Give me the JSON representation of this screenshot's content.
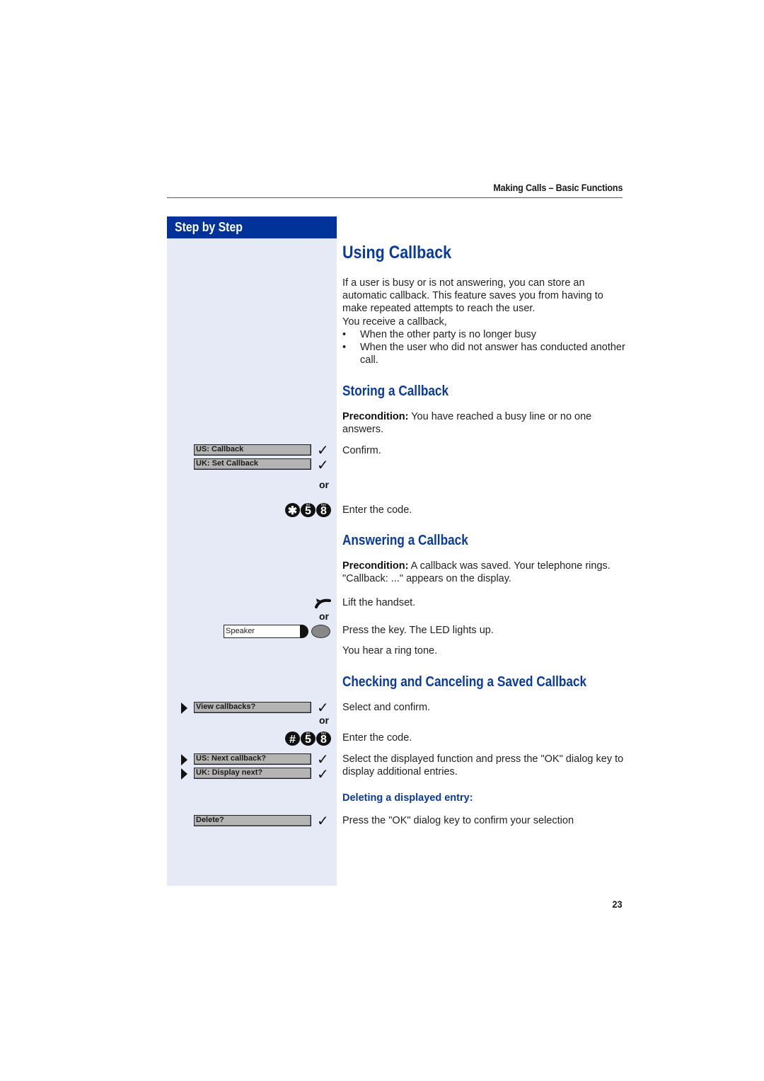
{
  "header": {
    "section_title": "Making Calls – Basic Functions"
  },
  "sidebar": {
    "heading": "Step by Step"
  },
  "main": {
    "title": "Using Callback",
    "intro": "If a user is busy or is not answering, you can store an automatic callback. This feature saves you from having to make repeated attempts to reach the user.",
    "receive_line": "You receive a callback,",
    "bullets": [
      "When the other party is no longer busy",
      "When the user who did not answer has conducted another call."
    ],
    "bullet_char": "•",
    "storing": {
      "heading": "Storing a Callback",
      "precondition_label": "Precondition:",
      "precondition_text": " You have reached a busy line or no one answers.",
      "confirm": "Confirm.",
      "enter_code": "Enter the code.",
      "displays": [
        "US: Callback",
        "UK: Set Callback"
      ],
      "or": "or",
      "code_keys": [
        {
          "main": "✱",
          "sub": ""
        },
        {
          "main": "5",
          "sub": "jkl"
        },
        {
          "main": "8",
          "sub": "tuv"
        }
      ]
    },
    "answering": {
      "heading": "Answering a Callback",
      "precondition_label": "Precondition:",
      "precondition_text": " A callback was saved. Your telephone rings. \"Callback: ...\" appears on the display.",
      "lift": "Lift the handset.",
      "or": "or",
      "speaker_label": "Speaker",
      "press_key": "Press the key. The LED lights up.",
      "ring_tone": "You hear a ring tone."
    },
    "checking": {
      "heading": "Checking and Canceling a Saved Callback",
      "view_display": "View callbacks?",
      "select_confirm": "Select and confirm.",
      "or": "or",
      "code_keys": [
        {
          "main": "#",
          "sub": ""
        },
        {
          "main": "5",
          "sub": "jkl"
        },
        {
          "main": "8",
          "sub": "tuv"
        }
      ],
      "enter_code": "Enter the code.",
      "next_displays": [
        "US: Next callback?",
        "UK: Display next?"
      ],
      "select_text": "Select the displayed function and press the \"OK\" dialog key to display additional entries.",
      "deleting_heading": "Deleting a displayed entry:",
      "delete_display": "Delete?",
      "delete_text": "Press the \"OK\" dialog key to confirm your selection"
    },
    "check_glyph": "✓"
  },
  "footer": {
    "page_number": "23"
  }
}
